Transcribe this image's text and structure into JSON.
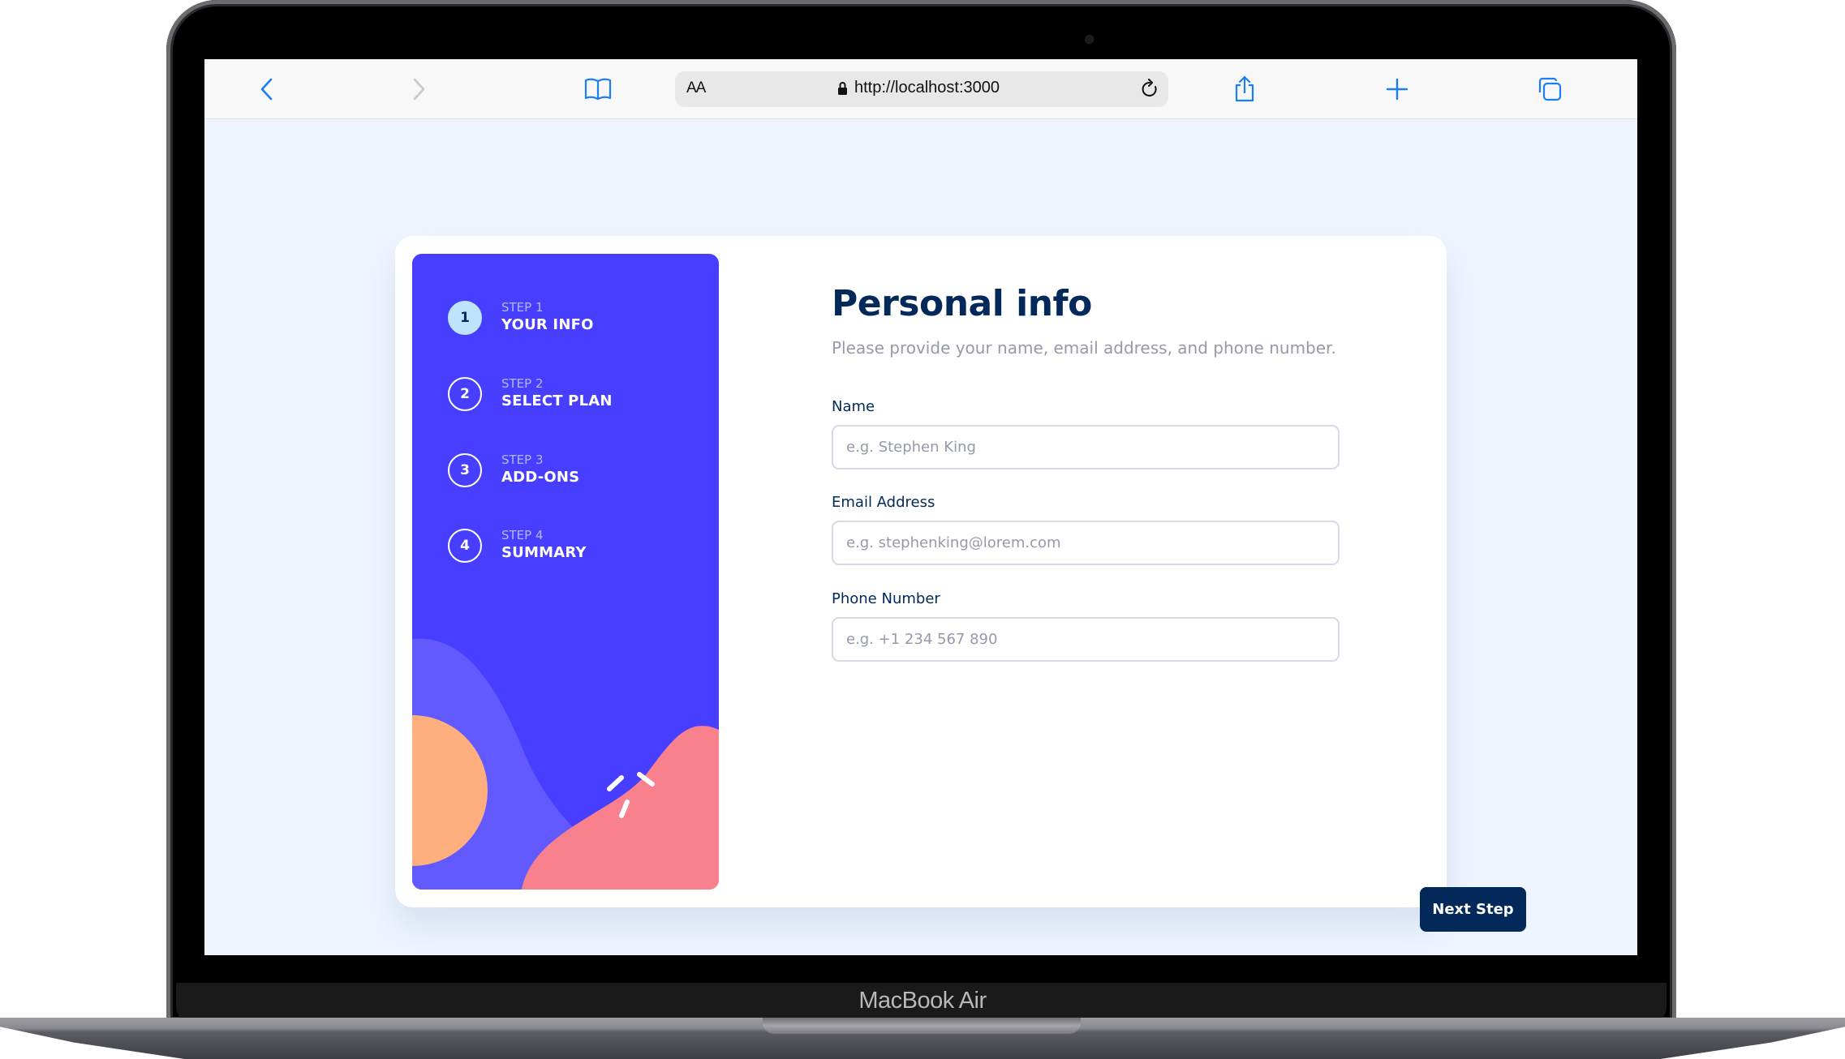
{
  "device": {
    "label": "MacBook Air"
  },
  "browser": {
    "reader_label": "AA",
    "url": "http://localhost:3000",
    "icons": {
      "back": "chevron-left-icon",
      "forward": "chevron-right-icon",
      "bookmarks": "book-icon",
      "lock": "lock-icon",
      "reload": "reload-icon",
      "share": "share-icon",
      "new_tab": "plus-icon",
      "tabs": "tabs-icon"
    }
  },
  "sidebar": {
    "steps": [
      {
        "number": "1",
        "sub": "STEP 1",
        "title": "YOUR INFO",
        "active": true
      },
      {
        "number": "2",
        "sub": "STEP 2",
        "title": "SELECT PLAN",
        "active": false
      },
      {
        "number": "3",
        "sub": "STEP 3",
        "title": "ADD-ONS",
        "active": false
      },
      {
        "number": "4",
        "sub": "STEP 4",
        "title": "SUMMARY",
        "active": false
      }
    ]
  },
  "form": {
    "title": "Personal info",
    "subtitle": "Please provide your name, email address, and phone number.",
    "fields": [
      {
        "label": "Name",
        "value": "",
        "placeholder": "e.g. Stephen King"
      },
      {
        "label": "Email Address",
        "value": "",
        "placeholder": "e.g. stephenking@lorem.com"
      },
      {
        "label": "Phone Number",
        "value": "",
        "placeholder": "e.g. +1 234 567 890"
      }
    ],
    "next_label": "Next Step"
  },
  "colors": {
    "sidebar_bg": "#483eff",
    "active_step": "#bfe2fd",
    "primary_text": "#02295a",
    "muted_text": "#9699aa",
    "button_bg": "#02295a",
    "page_bg": "#eff5ff",
    "browser_accent": "#1a7ff5"
  }
}
